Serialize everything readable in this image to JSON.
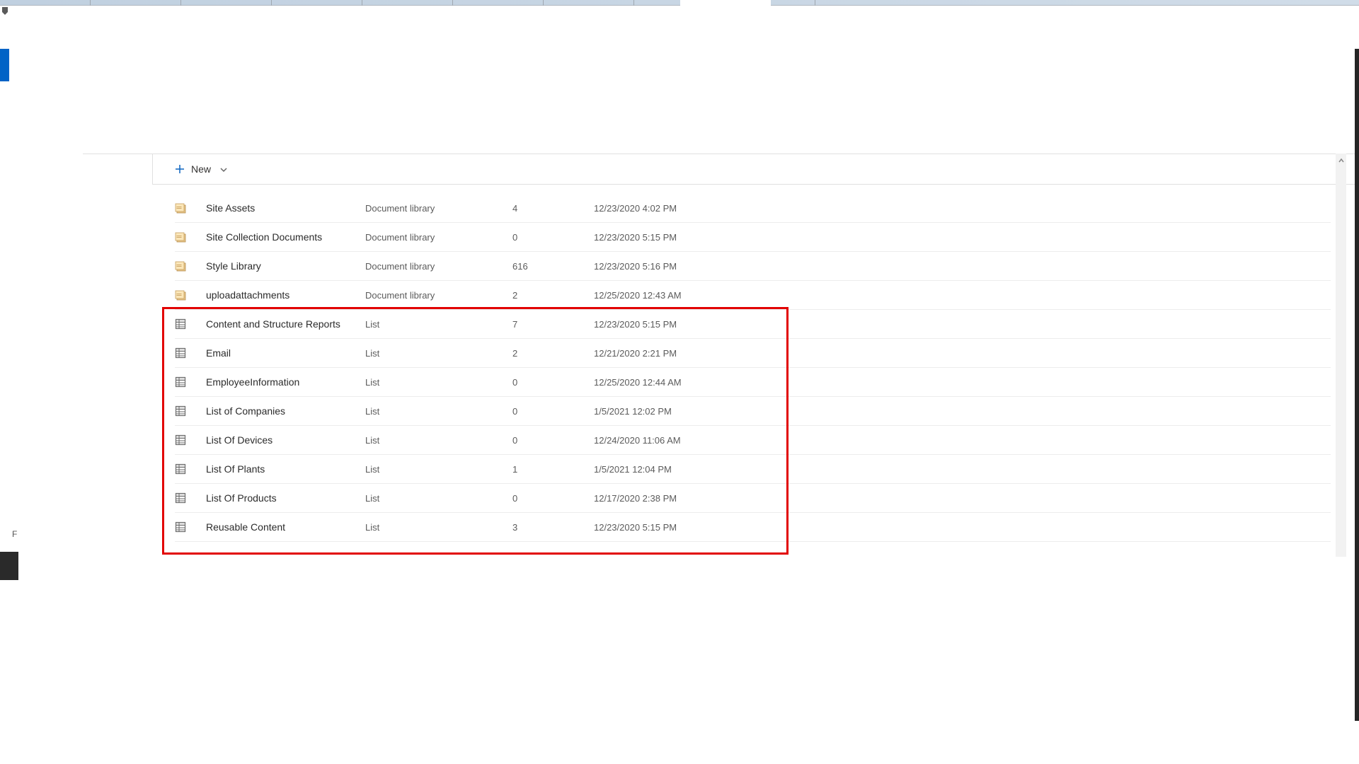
{
  "toolbar": {
    "new_label": "New"
  },
  "rows": [
    {
      "icon": "doclib",
      "name": "Site Assets",
      "type": "Document library",
      "count": "4",
      "modified": "12/23/2020 4:02 PM"
    },
    {
      "icon": "doclib",
      "name": "Site Collection Documents",
      "type": "Document library",
      "count": "0",
      "modified": "12/23/2020 5:15 PM"
    },
    {
      "icon": "doclib",
      "name": "Style Library",
      "type": "Document library",
      "count": "616",
      "modified": "12/23/2020 5:16 PM"
    },
    {
      "icon": "doclib",
      "name": "uploadattachments",
      "type": "Document library",
      "count": "2",
      "modified": "12/25/2020 12:43 AM"
    },
    {
      "icon": "list",
      "name": "Content and Structure Reports",
      "type": "List",
      "count": "7",
      "modified": "12/23/2020 5:15 PM"
    },
    {
      "icon": "list",
      "name": "Email",
      "type": "List",
      "count": "2",
      "modified": "12/21/2020 2:21 PM"
    },
    {
      "icon": "list",
      "name": "EmployeeInformation",
      "type": "List",
      "count": "0",
      "modified": "12/25/2020 12:44 AM"
    },
    {
      "icon": "list",
      "name": "List of Companies",
      "type": "List",
      "count": "0",
      "modified": "1/5/2021 12:02 PM"
    },
    {
      "icon": "list",
      "name": "List Of Devices",
      "type": "List",
      "count": "0",
      "modified": "12/24/2020 11:06 AM"
    },
    {
      "icon": "list",
      "name": "List Of Plants",
      "type": "List",
      "count": "1",
      "modified": "1/5/2021 12:04 PM"
    },
    {
      "icon": "list",
      "name": "List Of Products",
      "type": "List",
      "count": "0",
      "modified": "12/17/2020 2:38 PM"
    },
    {
      "icon": "list",
      "name": "Reusable Content",
      "type": "List",
      "count": "3",
      "modified": "12/23/2020 5:15 PM"
    }
  ],
  "left_letter": "F"
}
